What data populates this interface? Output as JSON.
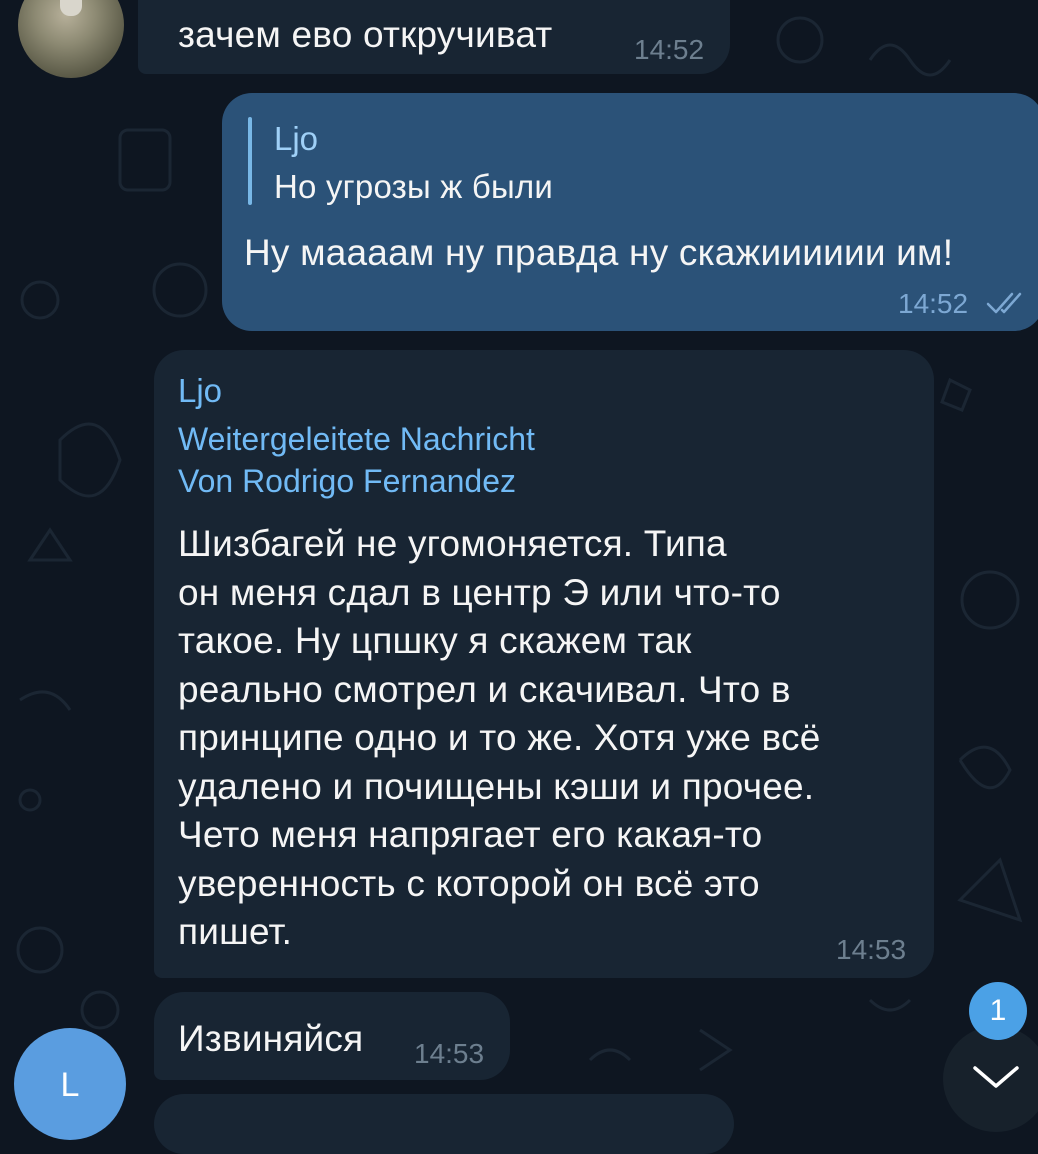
{
  "messages": [
    {
      "text": "зачем ево откручиват",
      "time": "14:52"
    },
    {
      "reply_name": "Ljo",
      "reply_text": "Но угрозы ж были",
      "text": "Ну маааам ну правда ну скажииииии им!",
      "time": "14:52"
    },
    {
      "sender": "Ljo",
      "forward_title": "Weitergeleitete Nachricht",
      "forward_from": "Von Rodrigo Fernandez",
      "lines": [
        "Шизбагей не угомоняется. Типа",
        "он меня сдал в центр Э или что-то",
        "такое. Ну цпшку я скажем так",
        "реально смотрел и скачивал. Что в",
        "принципе одно и то же. Хотя уже всё",
        "удалено и почищены кэши и прочее.",
        "Чето меня напрягает его какая-то",
        "уверенность с которой он всё это",
        "пишет."
      ],
      "time": "14:53"
    },
    {
      "text": "Извиняйся",
      "time": "14:53"
    }
  ],
  "avatar_letter": "L",
  "unread_count": "1",
  "colors": {
    "background": "#0e1621",
    "incoming_bubble": "#182533",
    "outgoing_bubble": "#2b5278",
    "accent": "#71baf5",
    "avatar_l": "#5a9de0",
    "badge": "#4ba1e6"
  },
  "icons": [
    "double-check-icon",
    "chevron-down-icon"
  ]
}
